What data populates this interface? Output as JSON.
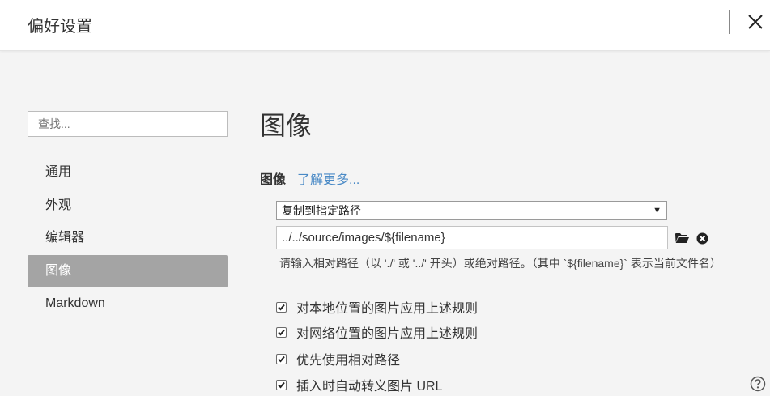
{
  "window": {
    "title": "偏好设置"
  },
  "search": {
    "placeholder": "查找..."
  },
  "sidebar": {
    "items": [
      {
        "label": "通用",
        "active": false
      },
      {
        "label": "外观",
        "active": false
      },
      {
        "label": "编辑器",
        "active": false
      },
      {
        "label": "图像",
        "active": true
      },
      {
        "label": "Markdown",
        "active": false
      }
    ]
  },
  "main": {
    "section_title": "图像",
    "subsection_label": "图像",
    "learn_more_link": "了解更多...",
    "action_select": {
      "selected": "复制到指定路径"
    },
    "path_input": {
      "value": "../../source/images/${filename}"
    },
    "hint": "请输入相对路径（以 './' 或 '../' 开头）或绝对路径。（其中 `${filename}` 表示当前文件名）",
    "options": [
      {
        "label": "对本地位置的图片应用上述规则",
        "checked": true
      },
      {
        "label": "对网络位置的图片应用上述规则",
        "checked": true
      },
      {
        "label": "优先使用相对路径",
        "checked": true
      },
      {
        "label": "插入时自动转义图片 URL",
        "checked": true
      }
    ]
  },
  "icons": {
    "close": "close-icon",
    "folder": "folder-icon",
    "clear": "clear-circle-icon",
    "help": "help-circle-icon"
  },
  "colors": {
    "active_nav_bg": "#a4a4a4",
    "link": "#4a8ac6",
    "background": "#f4f4f4"
  }
}
